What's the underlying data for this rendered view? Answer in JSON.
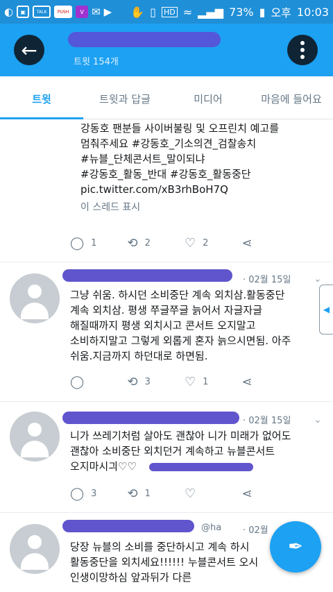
{
  "statusbar": {
    "battery": "73%",
    "ampm": "오후",
    "time": "10:03",
    "talk": "TALK",
    "push": "PUSH",
    "hd": "HD"
  },
  "header": {
    "tweet_count": "트윗 154개"
  },
  "tabs": [
    {
      "label": "트윗"
    },
    {
      "label": "트윗과 답글"
    },
    {
      "label": "미디어"
    },
    {
      "label": "마음에 들어요"
    }
  ],
  "tweets": [
    {
      "text_lines": [
        "강동호 팬분들 사이버불링 및 오프린치 예고를",
        "멈춰주세요 #강동호_기소의견_검찰송치",
        "#뉴블_단체콘서트_말이되냐",
        "#강동호_활동_반대 #강동호_활동중단",
        "pic.twitter.com/xB3rhBoH7Q"
      ],
      "thread_label": "이 스레드 표시",
      "replies": "1",
      "retweets": "2",
      "likes": "2"
    },
    {
      "date": "· 02월 15일",
      "text_lines": [
        "그냥 쉬움. 하시던 소비중단 계속 외치삼.활동중단",
        "계속 외치삼. 평생 쭈글쭈글 늙어서 자글자글",
        "해질때까지 평생 외치시고 콘서트 오지말고",
        "소비하지말고 그렇게 외롭게 혼자 늙으시면됨. 아주",
        "쉬움.지금까지 하던대로 하면됨."
      ],
      "replies": "",
      "retweets": "3",
      "likes": "1"
    },
    {
      "date": "· 02월 15일",
      "text_lines": [
        "니가 쓰레기처럼 살아도 괜찮아 니가 미래가 없어도",
        "괜찮아 소비중단 외치던거 계속하고 뉴블콘서트",
        "오지마시긔♡♡"
      ],
      "replies": "3",
      "retweets": "1",
      "likes": ""
    },
    {
      "handle": "@ha",
      "date": "· 02월",
      "text_lines": [
        "당장 뉴블의 소비를 중단하시고 계속 하시",
        "활동중단을 외치세요!!!!!! 누블콘서트 오시",
        "인생이망하심 앞과뒤가 다른"
      ]
    }
  ],
  "colors": {
    "brand": "#1da1f2",
    "statusbar": "#1f8fd8",
    "redaction": "#5246c9"
  }
}
